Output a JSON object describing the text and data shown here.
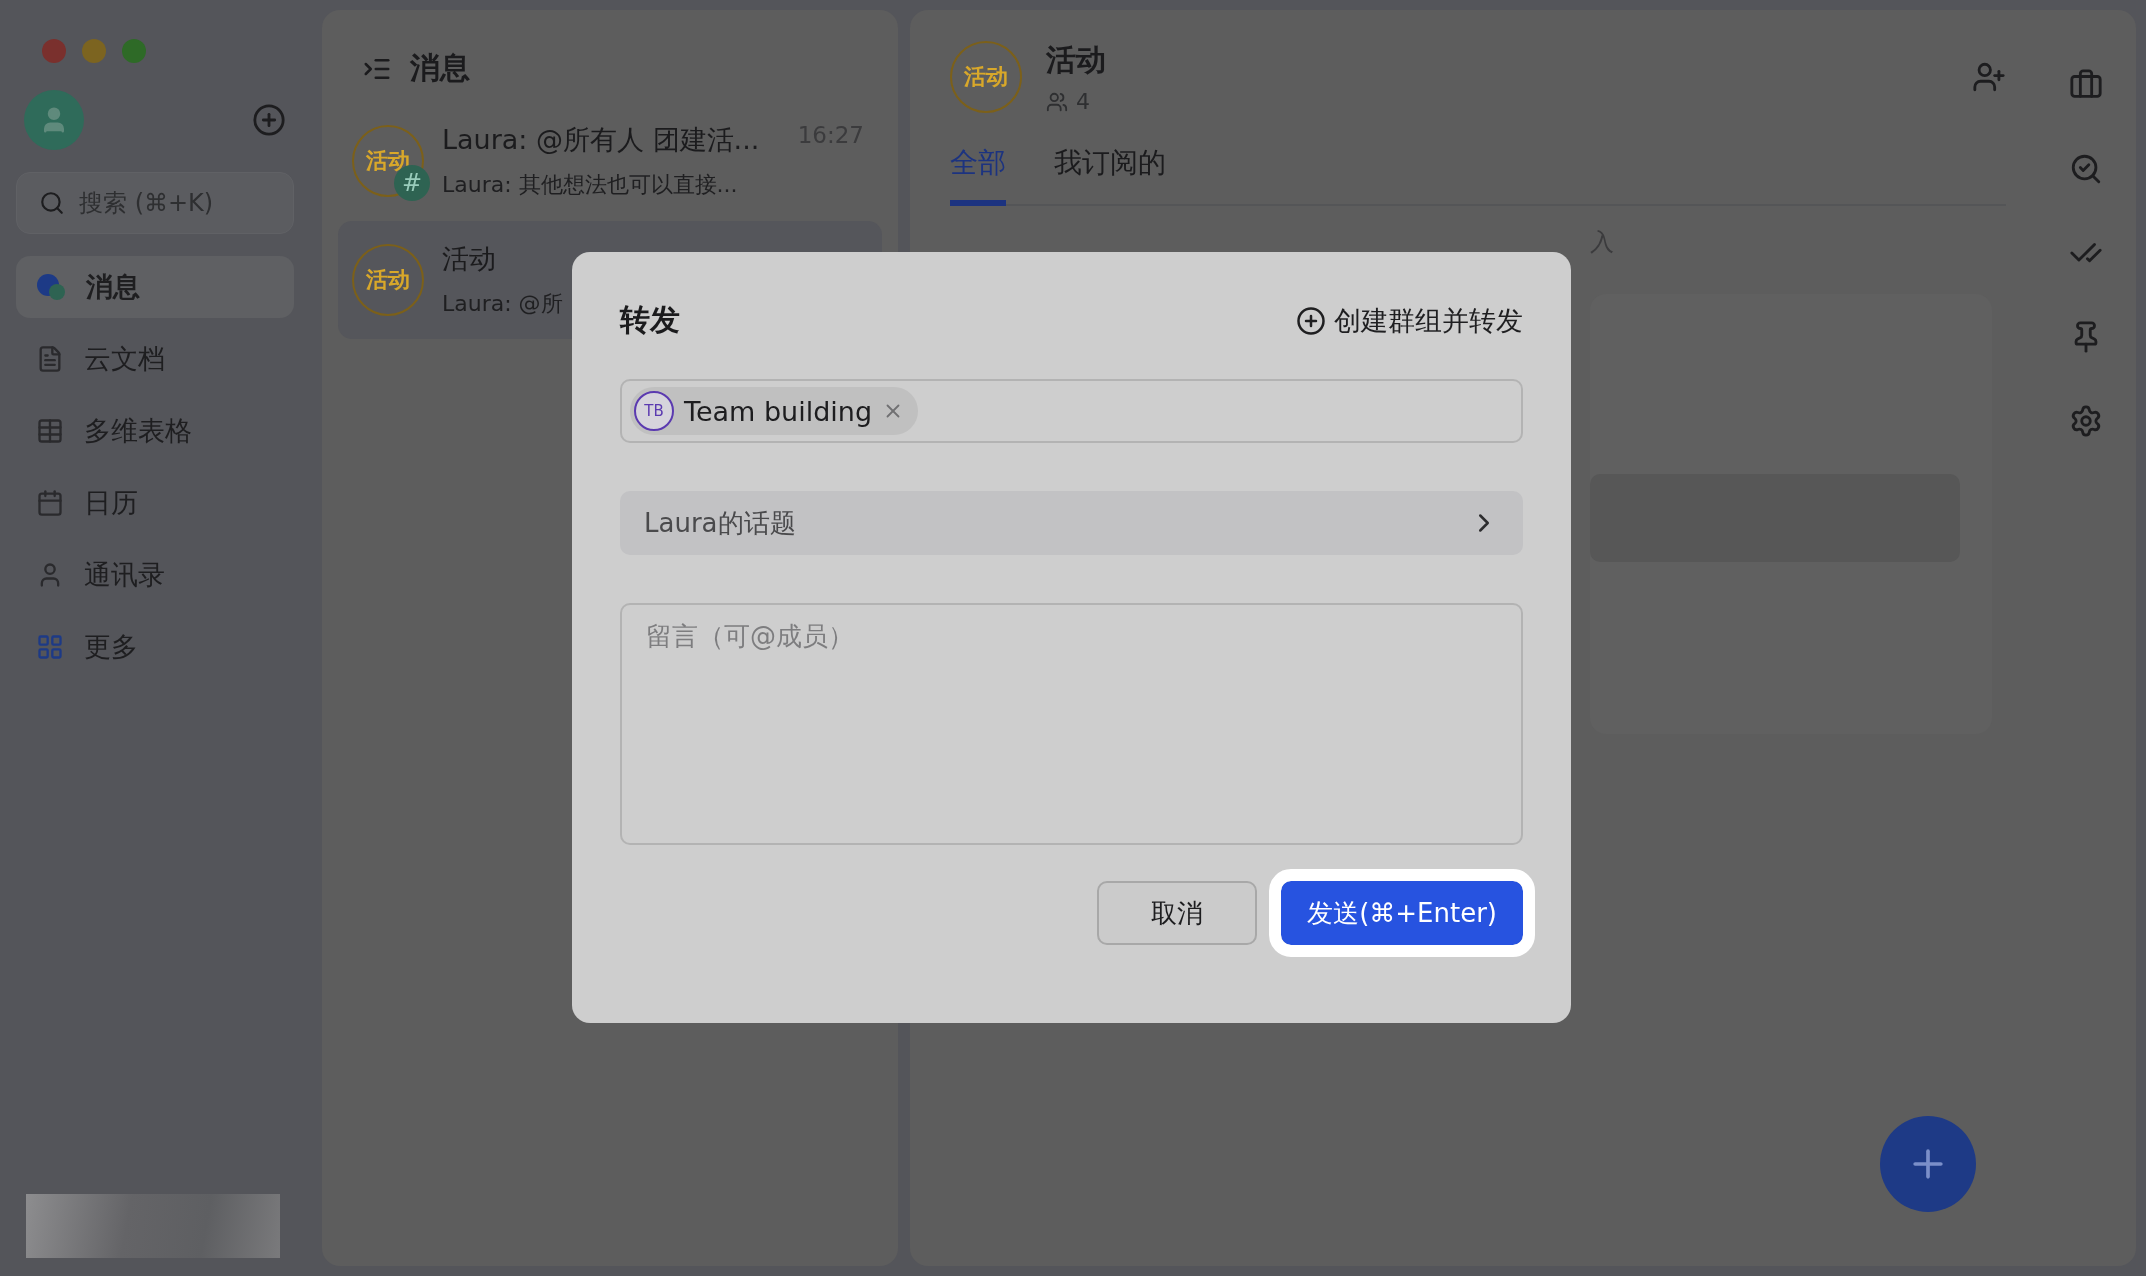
{
  "window": {
    "controls": [
      {
        "color": "#7a302d"
      },
      {
        "color": "#7c6420"
      },
      {
        "color": "#2e6a27"
      }
    ]
  },
  "sidebar": {
    "search": {
      "placeholder": "搜索 (⌘+K)"
    },
    "items": [
      {
        "label": "消息",
        "kind": "messages",
        "selected": true
      },
      {
        "label": "云文档",
        "kind": "docs",
        "selected": false
      },
      {
        "label": "多维表格",
        "kind": "table",
        "selected": false
      },
      {
        "label": "日历",
        "kind": "calendar",
        "selected": false
      },
      {
        "label": "通讯录",
        "kind": "contacts",
        "selected": false
      },
      {
        "label": "更多",
        "kind": "more",
        "selected": false
      }
    ]
  },
  "chat_list": {
    "title": "消息",
    "chats": [
      {
        "avatar": "活动",
        "title": "Laura: @所有人 团建活...",
        "time": "16:27",
        "preview": "Laura: 其他想法也可以直接...",
        "badge": "#",
        "selected": false
      },
      {
        "avatar": "活动",
        "title": "活动",
        "preview": "Laura: @所",
        "selected": true
      }
    ]
  },
  "main": {
    "avatar": "活动",
    "title": "活动",
    "member_count": "4",
    "tabs": [
      {
        "label": "全部",
        "selected": true
      },
      {
        "label": "我订阅的",
        "selected": false
      }
    ],
    "hint": "入"
  },
  "dialog": {
    "title": "转发",
    "create_group": "创建群组并转发",
    "recipients": [
      {
        "initials": "TB",
        "name": "Team building"
      }
    ],
    "topic": "Laura的话题",
    "message": {
      "placeholder": "留言（可@成员）"
    },
    "buttons": [
      {
        "label": "取消",
        "kind": "secondary",
        "highlighted": false
      },
      {
        "label": "发送(⌘+Enter)",
        "kind": "primary",
        "highlighted": true
      }
    ]
  }
}
